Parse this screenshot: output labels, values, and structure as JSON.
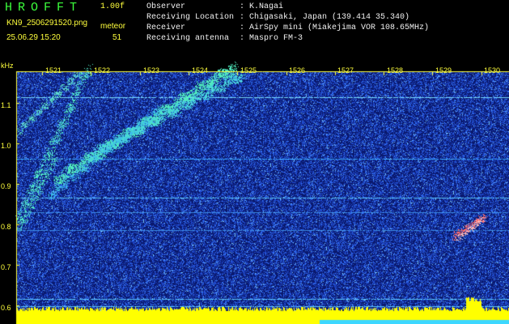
{
  "header": {
    "title": "HROFFT",
    "version": "1.00f",
    "filename": "KN9_2506291520.png",
    "meteor_label": "meteor",
    "datetime": "25.06.29 15:20",
    "meteor_count": "51",
    "info": [
      {
        "key": "Observer",
        "value": "K.Nagai"
      },
      {
        "key": "Receiving Location",
        "value": "Chigasaki, Japan (139.414 35.340)"
      },
      {
        "key": "Receiver",
        "value": "AirSpy mini (Miakejima VOR 108.65MHz)"
      },
      {
        "key": "Receiving antenna",
        "value": "Maspro FM-3"
      }
    ],
    "colors": {
      "title": "#3cff3c",
      "labels": "#ffff3c",
      "info": "#f0f0f0"
    }
  },
  "spectrogram": {
    "y_unit": "kHz",
    "time_ticks": [
      "1521",
      "1522",
      "1523",
      "1524",
      "1525",
      "1526",
      "1527",
      "1528",
      "1529",
      "1530"
    ],
    "freq_ticks": [
      "1.1",
      "1.0",
      "0.9",
      "0.8",
      "0.7",
      "0.6"
    ],
    "colors": {
      "background": "#0a1f6e",
      "noise": "#2f6bff",
      "signal": "#3cffb4",
      "meteor": "#ff6464",
      "bottom_bar": "#ffff00",
      "bottom_fill": "#3cd7ff"
    }
  }
}
